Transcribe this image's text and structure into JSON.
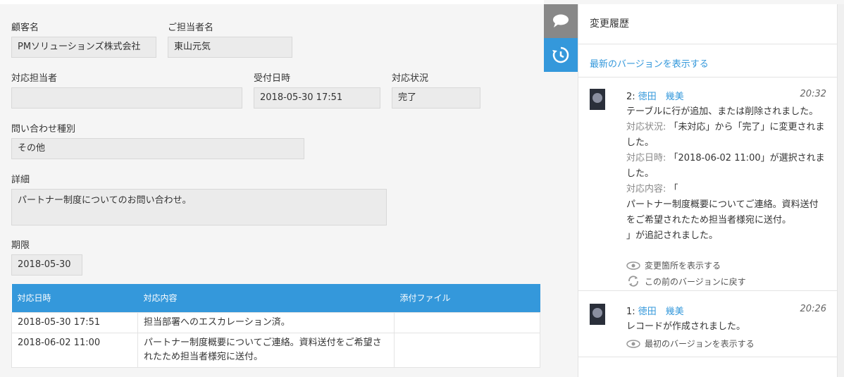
{
  "form": {
    "customer_label": "顧客名",
    "customer_value": "PMソリューションズ株式会社",
    "contact_label": "ご担当者名",
    "contact_value": "東山元気",
    "assignee_label": "対応担当者",
    "assignee_value": "",
    "received_label": "受付日時",
    "received_value": "2018-05-30 17:51",
    "status_label": "対応状況",
    "status_value": "完了",
    "type_label": "問い合わせ種別",
    "type_value": "その他",
    "detail_label": "詳細",
    "detail_value": "パートナー制度についてのお問い合わせ。",
    "deadline_label": "期限",
    "deadline_value": "2018-05-30"
  },
  "table": {
    "headers": [
      "対応日時",
      "対応内容",
      "添付ファイル"
    ],
    "rows": [
      [
        "2018-05-30 17:51",
        "担当部署へのエスカレーション済。",
        ""
      ],
      [
        "2018-06-02 11:00",
        "パートナー制度概要についてご連絡。資料送付をご希望されたため担当者様宛に送付。",
        ""
      ]
    ]
  },
  "tabs": {
    "comment_icon": "speech-bubble-icon",
    "history_icon": "history-clock-icon"
  },
  "history": {
    "title": "変更履歴",
    "latest_link": "最新のバージョンを表示する",
    "entries": [
      {
        "num": "2:",
        "user": "徳田　幾美",
        "time": "20:32",
        "line1": "テーブルに行が追加、または削除されました。",
        "f1_label": "対応状況:",
        "f1_text": "「未対応」から「完了」に変更されました。",
        "f2_label": "対応日時:",
        "f2_text": "「2018-06-02 11:00」が選択されました。",
        "f3_label": "対応内容:",
        "f3_text": "「",
        "f3_text2": "パートナー制度概要についてご連絡。資料送付をご希望されたため担当者様宛に送付。",
        "f3_text3": "」が追記されました。",
        "action1": "変更箇所を表示する",
        "action2": "この前のバージョンに戻す"
      },
      {
        "num": "1:",
        "user": "徳田　幾美",
        "time": "20:26",
        "line1": "レコードが作成されました。",
        "action1": "最初のバージョンを表示する"
      }
    ]
  },
  "colors": {
    "accent": "#3498db",
    "tab_inactive": "#888888",
    "field_bg": "#ebebeb"
  }
}
